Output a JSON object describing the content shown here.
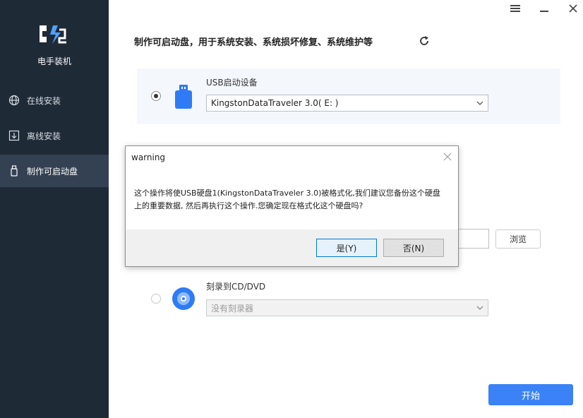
{
  "app": {
    "name": "电手装机",
    "brand_color": "#1f2a37",
    "accent_color": "#3b82f6"
  },
  "window_controls": {
    "menu_icon": "menu-icon",
    "minimize_icon": "minimize-icon",
    "close_icon": "close-icon"
  },
  "sidebar": {
    "items": [
      {
        "label": "在线安装",
        "icon": "globe-icon",
        "active": false
      },
      {
        "label": "离线安装",
        "icon": "download-box-icon",
        "active": false
      },
      {
        "label": "制作可启动盘",
        "icon": "usb-drive-icon",
        "active": true
      }
    ]
  },
  "main": {
    "headline": "制作可启动盘，用于系统安装、系统损坏修复、系统维护等",
    "usb_option": {
      "label": "USB启动设备",
      "selected": true,
      "device_value": "KingstonDataTraveler 3.0( E: )"
    },
    "cd_option": {
      "label": "刻录到CD/DVD",
      "selected": false,
      "device_value": "没有刻录器"
    },
    "browse_label": "浏览",
    "start_label": "开始"
  },
  "dialog": {
    "title": "warning",
    "message_line1": "这个操作将使USB硬盘1(KingstonDataTraveler 3.0)被格式化,我们建议您备份这个硬盘",
    "message_line2": "上的重要数据, 然后再执行这个操作.您确定现在格式化这个硬盘吗?",
    "yes_label": "是(Y)",
    "no_label": "否(N)"
  }
}
